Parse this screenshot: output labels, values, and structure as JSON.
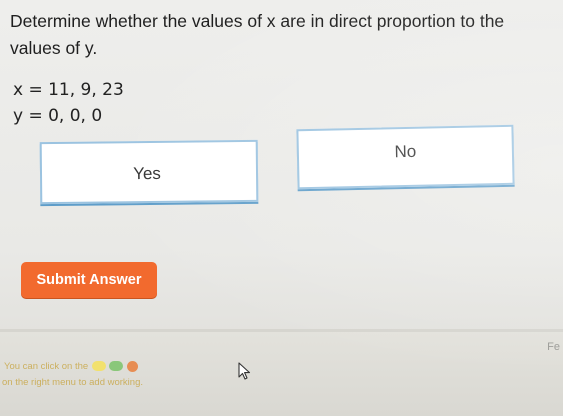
{
  "question": {
    "text": "Determine whether the values of x are in direct proportion to the values of y.",
    "x_values": "x = 11, 9, 23",
    "y_values": "y = 0, 0, 0"
  },
  "options": {
    "yes_label": "Yes",
    "no_label": "No"
  },
  "submit_label": "Submit Answer",
  "footer": {
    "hint_line1": "You can click on the",
    "hint_line2": "on the right menu to add working.",
    "corner_text": "Fe"
  },
  "colors": {
    "accent": "#f26a2e",
    "option_border": "#9bc3e0"
  }
}
